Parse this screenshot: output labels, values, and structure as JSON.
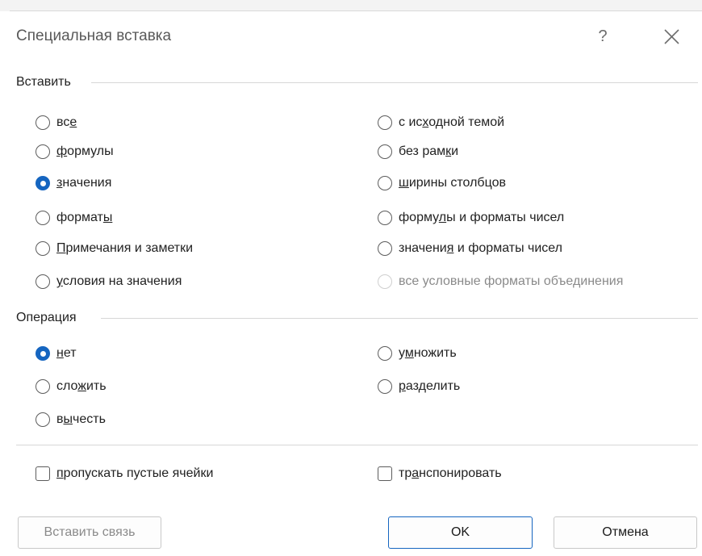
{
  "dialog": {
    "title": "Специальная вставка",
    "help_label": "?",
    "close_icon": "close-icon"
  },
  "paste": {
    "section_label": "Вставить",
    "options": [
      {
        "pre": "вс",
        "mn": "е",
        "post": "",
        "checked": false,
        "disabled": false
      },
      {
        "pre": "",
        "mn": "ф",
        "post": "ормулы",
        "checked": false,
        "disabled": false
      },
      {
        "pre": "",
        "mn": "з",
        "post": "начения",
        "checked": true,
        "disabled": false
      },
      {
        "pre": "формат",
        "mn": "ы",
        "post": "",
        "checked": false,
        "disabled": false
      },
      {
        "pre": "",
        "mn": "П",
        "post": "римечания и заметки",
        "checked": false,
        "disabled": false
      },
      {
        "pre": "",
        "mn": "у",
        "post": "словия на значения",
        "checked": false,
        "disabled": false
      },
      {
        "pre": "с ис",
        "mn": "х",
        "post": "одной темой",
        "checked": false,
        "disabled": false
      },
      {
        "pre": "без рам",
        "mn": "к",
        "post": "и",
        "checked": false,
        "disabled": false
      },
      {
        "pre": "",
        "mn": "ш",
        "post": "ирины столбцов",
        "checked": false,
        "disabled": false
      },
      {
        "pre": "форму",
        "mn": "л",
        "post": "ы и форматы чисел",
        "checked": false,
        "disabled": false
      },
      {
        "pre": "значени",
        "mn": "я",
        "post": " и форматы чисел",
        "checked": false,
        "disabled": false
      },
      {
        "pre": "все условные форматы объединения",
        "mn": "",
        "post": "",
        "checked": false,
        "disabled": true
      }
    ]
  },
  "operation": {
    "section_label": "Операция",
    "options": [
      {
        "pre": "",
        "mn": "н",
        "post": "ет",
        "checked": true,
        "disabled": false
      },
      {
        "pre": "сло",
        "mn": "ж",
        "post": "ить",
        "checked": false,
        "disabled": false
      },
      {
        "pre": "в",
        "mn": "ы",
        "post": "честь",
        "checked": false,
        "disabled": false
      },
      {
        "pre": "у",
        "mn": "м",
        "post": "ножить",
        "checked": false,
        "disabled": false
      },
      {
        "pre": "",
        "mn": "р",
        "post": "азделить",
        "checked": false,
        "disabled": false
      }
    ]
  },
  "checkboxes": [
    {
      "pre": "",
      "mn": "п",
      "post": "ропускать пустые ячейки",
      "checked": false
    },
    {
      "pre": "тр",
      "mn": "а",
      "post": "нспонировать",
      "checked": false
    }
  ],
  "buttons": {
    "paste_link": "Вставить связь",
    "ok": "OK",
    "cancel": "Отмена"
  }
}
